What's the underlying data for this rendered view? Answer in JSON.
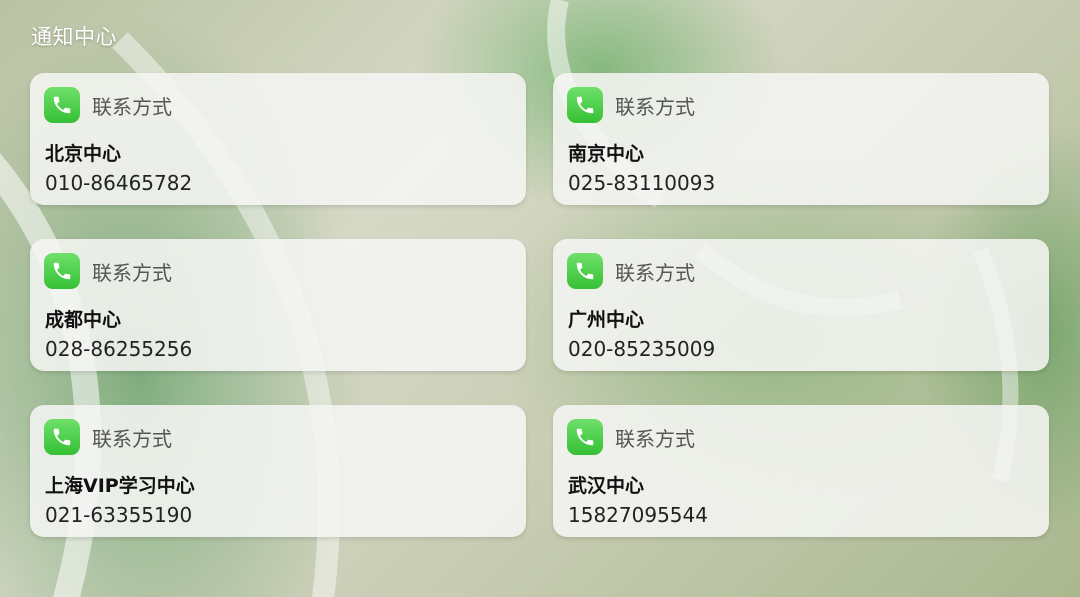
{
  "header": {
    "title": "通知中心"
  },
  "cards": [
    {
      "label": "联系方式",
      "name": "北京中心",
      "phone": "010-86465782"
    },
    {
      "label": "联系方式",
      "name": "南京中心",
      "phone": "025-83110093"
    },
    {
      "label": "联系方式",
      "name": "成都中心",
      "phone": "028-86255256"
    },
    {
      "label": "联系方式",
      "name": "广州中心",
      "phone": "020-85235009"
    },
    {
      "label": "联系方式",
      "name": "上海VIP学习中心",
      "phone": "021-63355190"
    },
    {
      "label": "联系方式",
      "name": "武汉中心",
      "phone": "15827095544"
    }
  ],
  "icons": {
    "card_icon": "phone-icon"
  },
  "colors": {
    "icon_green": "#4cd14a",
    "card_bg": "#f6f6f4"
  }
}
